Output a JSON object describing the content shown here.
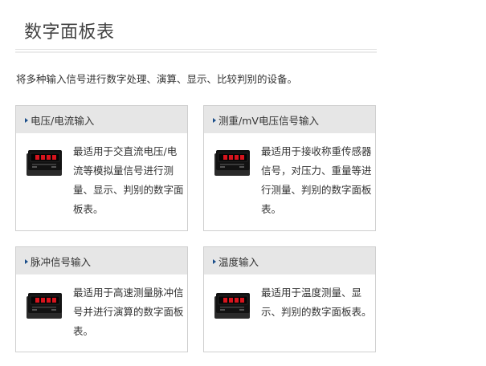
{
  "page": {
    "title": "数字面板表",
    "intro": "将多种输入信号进行数字处理、演算、显示、比较判别的设备。"
  },
  "cards": [
    {
      "title": "电压/电流输入",
      "description": "最适用于交直流电压/电流等模拟量信号进行测量、显示、判别的数字面板表。",
      "icon": "panel-meter-icon"
    },
    {
      "title": "测重/mV电压信号输入",
      "description": "最适用于接收称重传感器信号，对压力、重量等进行测量、判别的数字面板表。",
      "icon": "panel-meter-icon"
    },
    {
      "title": "脉冲信号输入",
      "description": "最适用于高速测量脉冲信号并进行演算的数字面板表。",
      "icon": "panel-meter-icon"
    },
    {
      "title": "温度输入",
      "description": "最适用于温度测量、显示、判别的数字面板表。",
      "icon": "panel-meter-icon"
    }
  ],
  "colors": {
    "header_bg": "#e6e6e6",
    "arrow": "#1b4e8a",
    "border": "#cfcfcf",
    "display_red": "#d8141d"
  }
}
